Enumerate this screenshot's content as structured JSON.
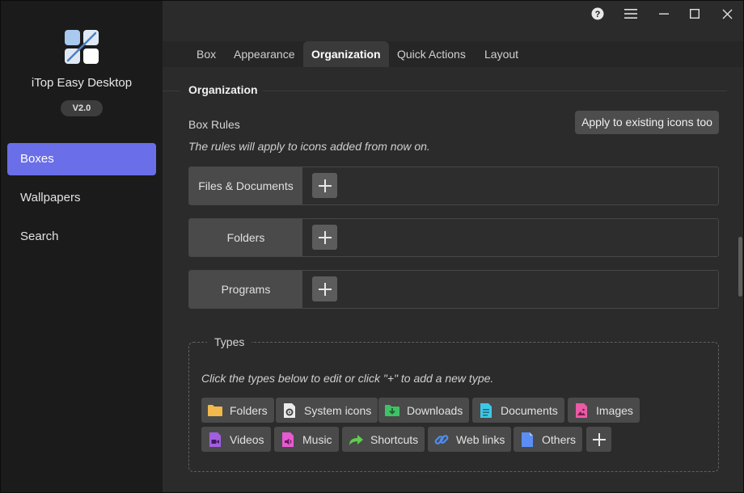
{
  "app": {
    "name": "iTop Easy Desktop",
    "version": "V2.0",
    "accent": "#6a6ee8"
  },
  "sidebar": {
    "items": [
      {
        "label": "Boxes",
        "active": true
      },
      {
        "label": "Wallpapers",
        "active": false
      },
      {
        "label": "Search",
        "active": false
      }
    ]
  },
  "titlebar": {
    "icons": [
      "help-icon",
      "menu-icon",
      "minimize-icon",
      "maximize-icon",
      "close-icon"
    ]
  },
  "tabs": [
    {
      "label": "Box",
      "active": false
    },
    {
      "label": "Appearance",
      "active": false
    },
    {
      "label": "Organization",
      "active": true
    },
    {
      "label": "Quick Actions",
      "active": false
    },
    {
      "label": "Layout",
      "active": false
    }
  ],
  "organization": {
    "section_title": "Organization",
    "box_rules_label": "Box Rules",
    "rules_hint": "The rules will apply to icons added from now on.",
    "apply_button": "Apply to existing icons too",
    "rules": [
      {
        "name": "Files & Documents"
      },
      {
        "name": "Folders"
      },
      {
        "name": "Programs"
      }
    ]
  },
  "types": {
    "legend": "Types",
    "hint": "Click the types below to edit or click \"+\" to add a new type.",
    "chips": [
      {
        "label": "Folders",
        "icon": "folder-icon",
        "color": "#f2b84b"
      },
      {
        "label": "System icons",
        "icon": "system-file-icon",
        "color": "#e8e8e8"
      },
      {
        "label": "Downloads",
        "icon": "downloads-folder-icon",
        "color": "#3fc266"
      },
      {
        "label": "Documents",
        "icon": "document-icon",
        "color": "#3dc7e6"
      },
      {
        "label": "Images",
        "icon": "image-icon",
        "color": "#ea5aa6"
      },
      {
        "label": "Videos",
        "icon": "video-icon",
        "color": "#a35ee0"
      },
      {
        "label": "Music",
        "icon": "music-icon",
        "color": "#e85ad2"
      },
      {
        "label": "Shortcuts",
        "icon": "shortcut-icon",
        "color": "#5ccf4a"
      },
      {
        "label": "Web links",
        "icon": "link-icon",
        "color": "#4d8ef0"
      },
      {
        "label": "Others",
        "icon": "other-file-icon",
        "color": "#5b8ef5"
      }
    ]
  }
}
